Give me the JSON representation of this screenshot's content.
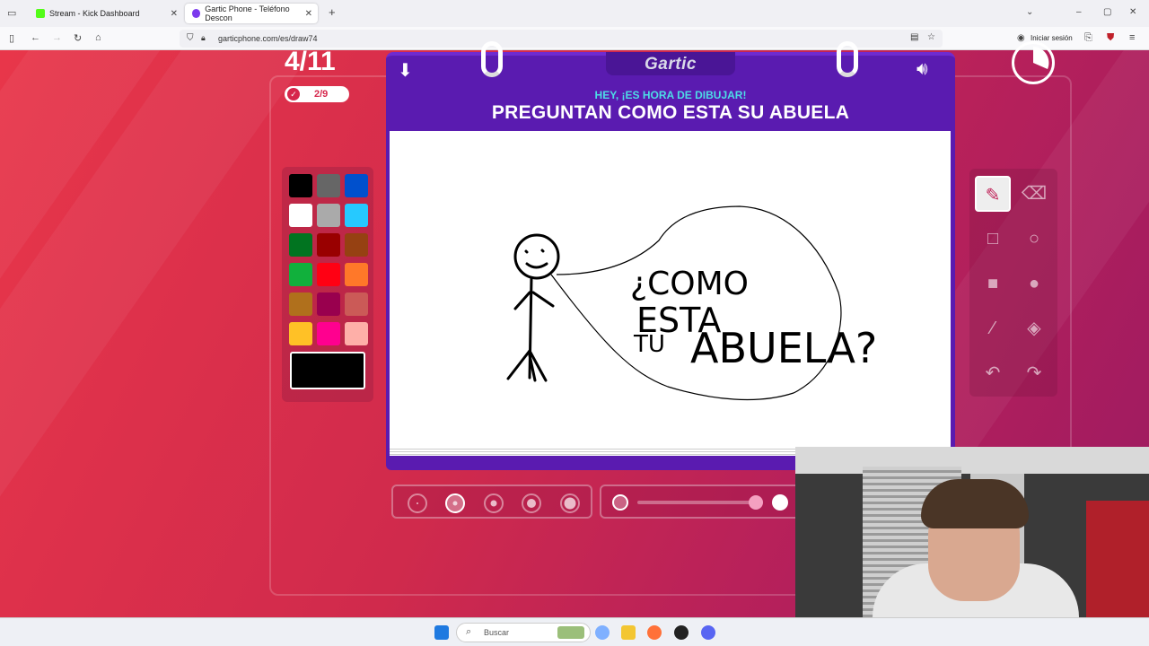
{
  "browser": {
    "tabs": [
      {
        "label": "Stream - Kick Dashboard",
        "favicon_color": "#53fc18"
      },
      {
        "label": "Gartic Phone - Teléfono Descon",
        "favicon_color": "#7c3aed"
      }
    ],
    "url": "garticphone.com/es/draw74",
    "signin_label": "Iniciar sesión",
    "new_tab": "+",
    "close": "✕"
  },
  "game": {
    "round": "4/11",
    "done_count": "2/9",
    "logo": "Gartic",
    "subtitle": "HEY, ¡ES HORA DE DIBUJAR!",
    "prompt": "PREGUNTAN COMO ESTA SU ABUELA",
    "drawing_text": [
      "¿COMO",
      "ESTA",
      "TU",
      "ABUELA?"
    ],
    "palette": [
      "#000000",
      "#666666",
      "#0050cd",
      "#ffffff",
      "#aaaaaa",
      "#26c9ff",
      "#017420",
      "#990000",
      "#964112",
      "#11b03c",
      "#ff0013",
      "#ff7829",
      "#b0701c",
      "#99004e",
      "#cb5a57",
      "#ffc126",
      "#ff008f",
      "#feafa8"
    ],
    "current_color": "#000000",
    "tools": [
      "pencil",
      "eraser",
      "rect-outline",
      "circle-outline",
      "rect-fill",
      "circle-fill",
      "line",
      "bucket",
      "undo",
      "redo"
    ],
    "selected_tool": "pencil"
  },
  "taskbar": {
    "search_placeholder": "Buscar"
  }
}
